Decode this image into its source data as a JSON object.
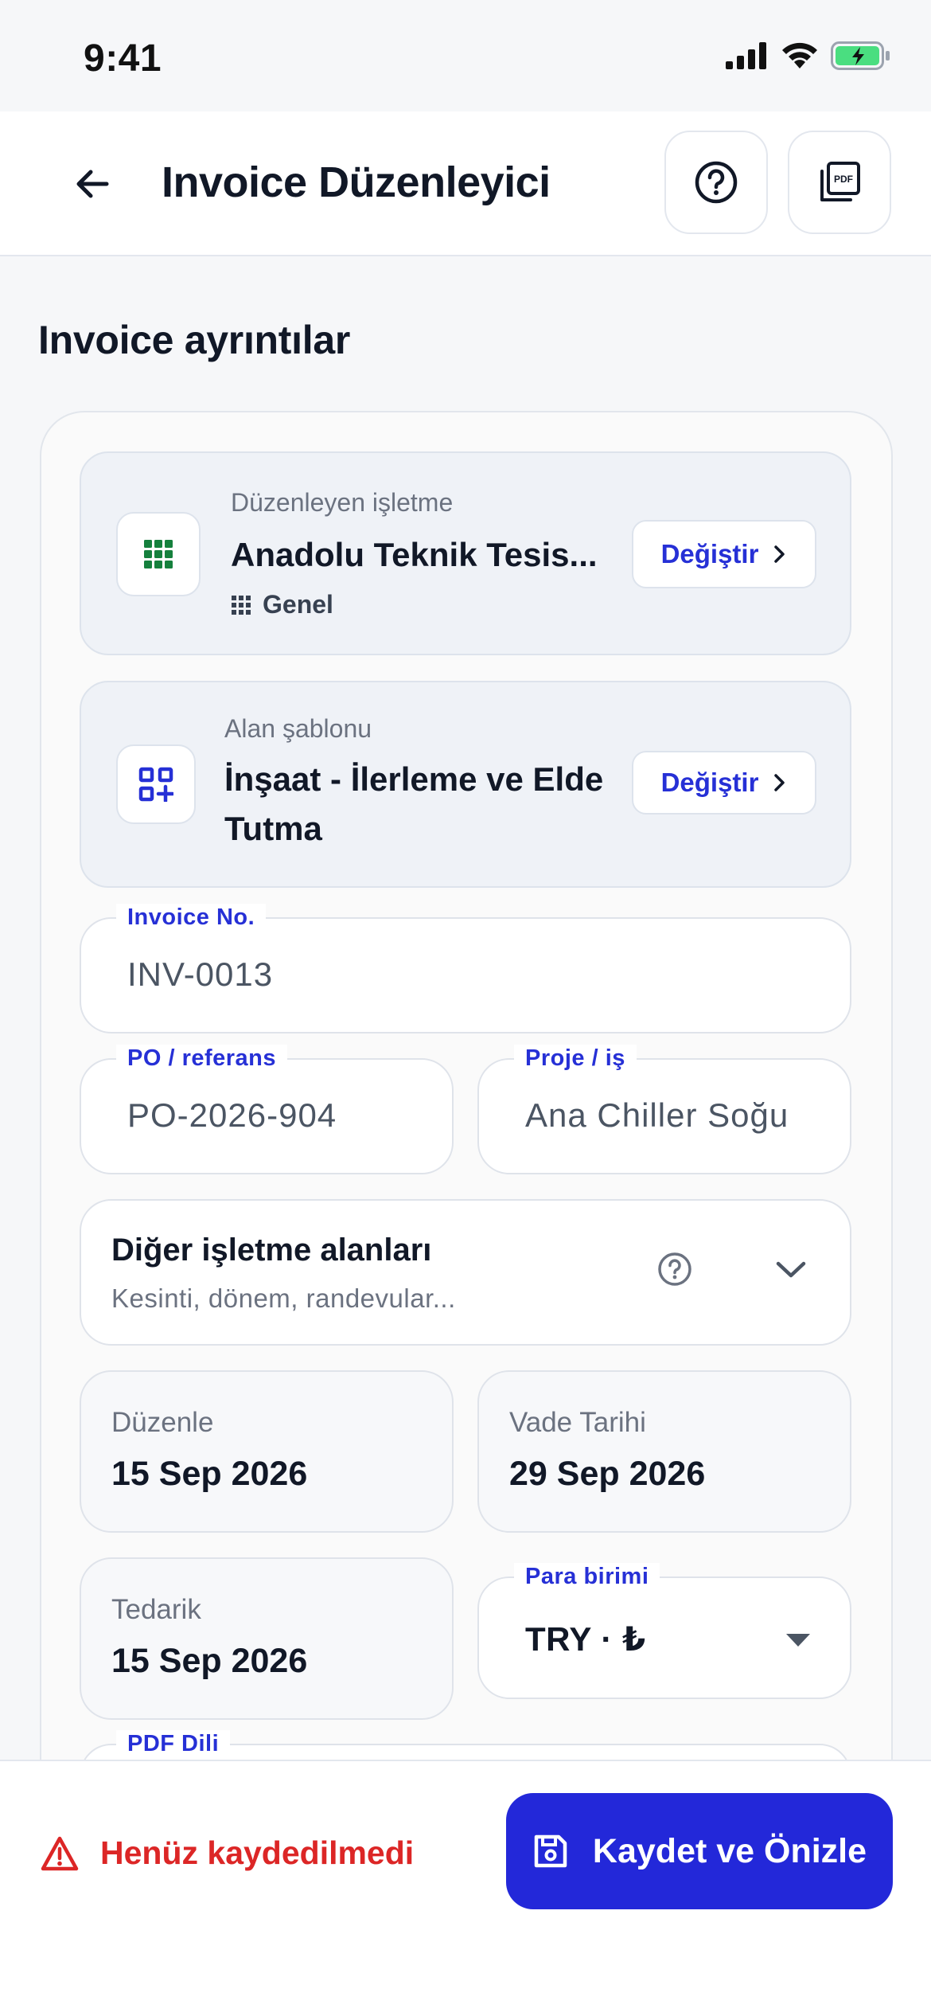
{
  "status_bar": {
    "time": "9:41"
  },
  "header": {
    "title": "Invoice Düzenleyici"
  },
  "section": {
    "title": "Invoice ayrıntılar"
  },
  "issuer": {
    "label": "Düzenleyen işletme",
    "value": "Anadolu Teknik Tesis...",
    "sub": "Genel",
    "change_label": "Değiştir"
  },
  "template": {
    "label": "Alan şablonu",
    "value_line1": "İnşaat - İlerleme ve Elde",
    "value_line2": "Tutma",
    "change_label": "Değiştir"
  },
  "fields": {
    "invoice_no": {
      "label": "Invoice No.",
      "value": "INV-0013"
    },
    "po": {
      "label": "PO / referans",
      "value": "PO-2026-904"
    },
    "project": {
      "label": "Proje / iş",
      "value": "Ana Chiller Soğu"
    },
    "currency": {
      "label": "Para birimi",
      "value": "TRY · ₺"
    },
    "pdf_lang": {
      "label": "PDF Dili"
    }
  },
  "other_fields": {
    "title": "Diğer işletme alanları",
    "subtitle": "Kesinti, dönem, randevular..."
  },
  "dates": {
    "issue": {
      "label": "Düzenle",
      "value": "15 Sep 2026"
    },
    "due": {
      "label": "Vade Tarihi",
      "value": "29 Sep 2026"
    },
    "supply": {
      "label": "Tedarik",
      "value": "15 Sep 2026"
    }
  },
  "footer": {
    "unsaved_label": "Henüz kaydedilmedi",
    "save_label": "Kaydet ve Önizle"
  },
  "colors": {
    "accent": "#2328d9",
    "warning": "#dc2626",
    "grid_icon": "#15803d"
  }
}
